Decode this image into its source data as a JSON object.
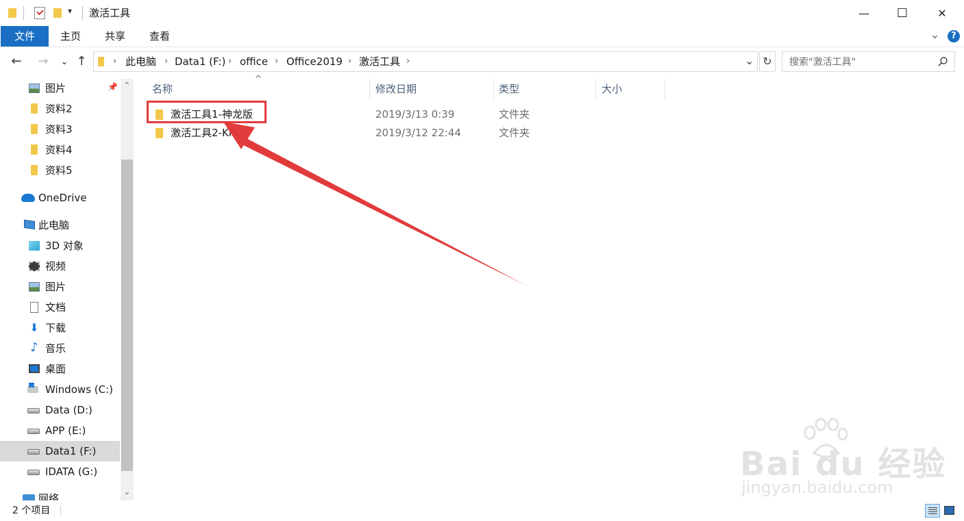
{
  "window": {
    "title": "激活工具",
    "controls": {
      "minimize": "—",
      "maximize": "☐",
      "close": "✕"
    },
    "qat_dropdown": "▾"
  },
  "ribbon": {
    "tabs": [
      "文件",
      "主页",
      "共享",
      "查看"
    ],
    "collapse_icon": "⌄",
    "help_label": "?"
  },
  "nav": {
    "back": "←",
    "forward": "→",
    "recent": "⌄",
    "up": "↑"
  },
  "address": {
    "crumbs": [
      "此电脑",
      "Data1 (F:)",
      "office",
      "Office2019",
      "激活工具"
    ],
    "separator": "›",
    "dropdown": "⌄",
    "refresh": "↻"
  },
  "search": {
    "placeholder": "搜索\"激活工具\"",
    "icon": "search-icon"
  },
  "sidebar": {
    "pin_icon": "pin-icon",
    "items": [
      {
        "label": "图片",
        "icon": "picture-icon"
      },
      {
        "label": "资料2",
        "icon": "folder-icon"
      },
      {
        "label": "资料3",
        "icon": "folder-icon"
      },
      {
        "label": "资料4",
        "icon": "folder-icon"
      },
      {
        "label": "资料5",
        "icon": "folder-icon"
      },
      {
        "label": "OneDrive",
        "icon": "onedrive-icon"
      },
      {
        "label": "此电脑",
        "icon": "this-pc-icon"
      },
      {
        "label": "3D 对象",
        "icon": "3d-objects-icon"
      },
      {
        "label": "视频",
        "icon": "video-icon"
      },
      {
        "label": "图片",
        "icon": "picture-icon"
      },
      {
        "label": "文档",
        "icon": "document-icon"
      },
      {
        "label": "下载",
        "icon": "download-icon"
      },
      {
        "label": "音乐",
        "icon": "music-icon"
      },
      {
        "label": "桌面",
        "icon": "desktop-icon"
      },
      {
        "label": "Windows (C:)",
        "icon": "windows-drive-icon"
      },
      {
        "label": "Data (D:)",
        "icon": "drive-icon"
      },
      {
        "label": "APP (E:)",
        "icon": "drive-icon"
      },
      {
        "label": "Data1 (F:)",
        "icon": "drive-icon",
        "selected": true
      },
      {
        "label": "IDATA (G:)",
        "icon": "drive-icon"
      },
      {
        "label": "网络",
        "icon": "network-icon"
      }
    ]
  },
  "file_list": {
    "sort_indicator": "^",
    "columns": [
      "名称",
      "修改日期",
      "类型",
      "大小"
    ],
    "rows": [
      {
        "name": "激活工具1-神龙版",
        "modified": "2019/3/13 0:39",
        "type": "文件夹",
        "size": ""
      },
      {
        "name": "激活工具2-KMS",
        "modified": "2019/3/12 22:44",
        "type": "文件夹",
        "size": ""
      }
    ]
  },
  "annotation": {
    "highlight_color": "#e23b3b",
    "arrow_color": "#e23b3b"
  },
  "status": {
    "item_count": "2 个项目"
  },
  "watermark": {
    "brand": "Bai du 经验",
    "url": "jingyan.baidu.com"
  },
  "colors": {
    "accent": "#1a6fc4",
    "selected_bg": "#d9d9d9",
    "folder": "#f2c84b"
  }
}
